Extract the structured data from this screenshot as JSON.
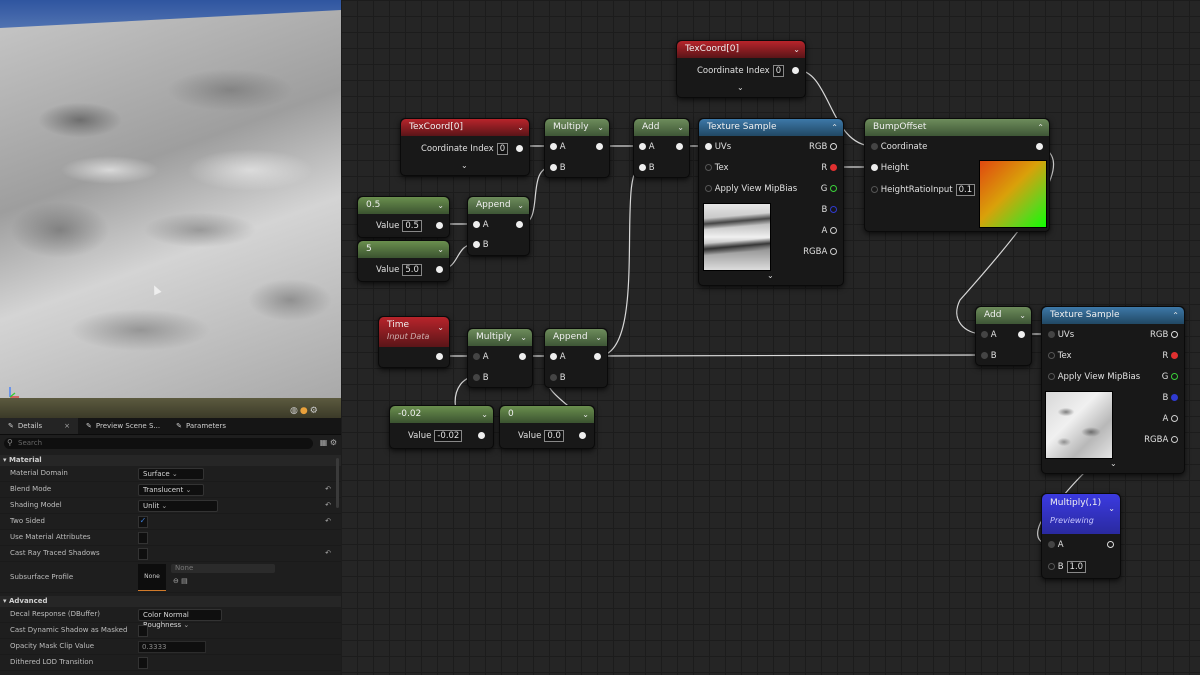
{
  "viewport": {},
  "details_panel": {
    "tabs": [
      {
        "label": "Details",
        "icon": "pencil-icon"
      },
      {
        "label": "Preview Scene S...",
        "icon": "pencil-icon"
      },
      {
        "label": "Parameters",
        "icon": "pencil-icon"
      }
    ],
    "search_placeholder": "Search",
    "sections": {
      "material": "Material",
      "advanced": "Advanced"
    },
    "properties": {
      "material_domain": {
        "label": "Material Domain",
        "value": "Surface"
      },
      "blend_mode": {
        "label": "Blend Mode",
        "value": "Translucent"
      },
      "shading_model": {
        "label": "Shading Model",
        "value": "Unlit"
      },
      "two_sided": {
        "label": "Two Sided",
        "checked": true
      },
      "use_material_attributes": {
        "label": "Use Material Attributes",
        "checked": false
      },
      "cast_ray_traced_shadows": {
        "label": "Cast Ray Traced Shadows",
        "checked": false
      },
      "subsurface_profile": {
        "label": "Subsurface Profile",
        "thumb": "None",
        "value": "None"
      },
      "decal_response": {
        "label": "Decal Response (DBuffer)",
        "value": "Color Normal Roughness"
      },
      "cast_dynamic_shadow": {
        "label": "Cast Dynamic Shadow as Masked",
        "checked": false
      },
      "opacity_mask_clip": {
        "label": "Opacity Mask Clip Value",
        "value": "0.3333"
      },
      "dithered_lod": {
        "label": "Dithered LOD Transition",
        "checked": false
      }
    }
  },
  "graph": {
    "nodes": {
      "texcoord_top": {
        "title": "TexCoord[0]",
        "pin": "Coordinate Index",
        "value": "0"
      },
      "texcoord_left": {
        "title": "TexCoord[0]",
        "pin": "Coordinate Index",
        "value": "0"
      },
      "const_05": {
        "title": "0.5",
        "pin": "Value",
        "value": "0.5"
      },
      "const_5": {
        "title": "5",
        "pin": "Value",
        "value": "5.0"
      },
      "append_1": {
        "title": "Append",
        "pin_a": "A",
        "pin_b": "B"
      },
      "multiply_1": {
        "title": "Multiply",
        "pin_a": "A",
        "pin_b": "B"
      },
      "add_1": {
        "title": "Add",
        "pin_a": "A",
        "pin_b": "B"
      },
      "texsample_1": {
        "title": "Texture Sample",
        "in_uvs": "UVs",
        "in_tex": "Tex",
        "in_mip": "Apply View MipBias",
        "out_rgb": "RGB",
        "out_r": "R",
        "out_g": "G",
        "out_b": "B",
        "out_a": "A",
        "out_rgba": "RGBA"
      },
      "bumpoffset": {
        "title": "BumpOffset",
        "in_coord": "Coordinate",
        "in_height": "Height",
        "in_ratio": "HeightRatioInput",
        "ratio_value": "0.1"
      },
      "time": {
        "title": "Time",
        "subtitle": "Input Data"
      },
      "multiply_2": {
        "title": "Multiply",
        "pin_a": "A",
        "pin_b": "B"
      },
      "append_2": {
        "title": "Append",
        "pin_a": "A",
        "pin_b": "B"
      },
      "const_neg002": {
        "title": "-0.02",
        "pin": "Value",
        "value": "-0.02"
      },
      "const_0": {
        "title": "0",
        "pin": "Value",
        "value": "0.0"
      },
      "add_2": {
        "title": "Add",
        "pin_a": "A",
        "pin_b": "B"
      },
      "texsample_2": {
        "title": "Texture Sample",
        "in_uvs": "UVs",
        "in_tex": "Tex",
        "in_mip": "Apply View MipBias",
        "out_rgb": "RGB",
        "out_r": "R",
        "out_g": "G",
        "out_b": "B",
        "out_a": "A",
        "out_rgba": "RGBA"
      },
      "multiply_preview": {
        "title": "Multiply(,1)",
        "subtitle": "Previewing",
        "pin_a": "A",
        "pin_b": "B",
        "b_value": "1.0"
      }
    }
  },
  "colors": {
    "header_red": "#b8242b",
    "header_green": "#6a8f4e",
    "header_blue": "#3d78a8",
    "header_purple": "#3b3ae0",
    "pin_r": "#e03030",
    "pin_g": "#3ad13a",
    "pin_b": "#2f3ad0"
  }
}
